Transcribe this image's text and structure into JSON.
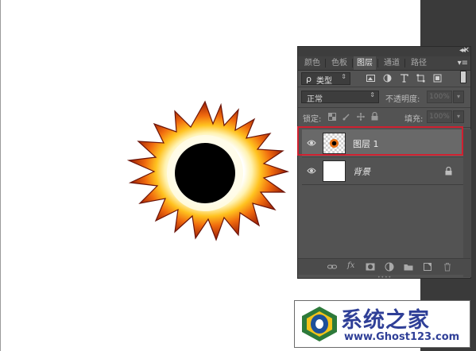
{
  "panel": {
    "tabs": [
      {
        "label": "颜色",
        "active": false
      },
      {
        "label": "色板",
        "active": false
      },
      {
        "label": "图层",
        "active": true
      },
      {
        "label": "通道",
        "active": false
      },
      {
        "label": "路径",
        "active": false
      }
    ],
    "filter": {
      "search_symbol": "ρ",
      "kind_label": "类型"
    },
    "blend_mode": "正常",
    "opacity_label": "不透明度:",
    "opacity_value": "100%",
    "lock_label": "锁定:",
    "fill_label": "填充:",
    "fill_value": "100%",
    "layers": [
      {
        "name": "图层 1",
        "selected": true,
        "visible": true,
        "locked": false
      },
      {
        "name": "背景",
        "selected": false,
        "visible": true,
        "locked": true
      }
    ],
    "bottom_icons": [
      "link-icon",
      "fx-icon",
      "mask-icon",
      "adjustment-icon",
      "folder-icon",
      "new-layer-icon",
      "trash-icon"
    ],
    "fx_label": "fx"
  },
  "watermark": {
    "name": "系统之家",
    "url": "www.Ghost123.com"
  },
  "colors": {
    "panel_bg": "#535353",
    "selected_row": "#696969",
    "highlight_border": "#d02030",
    "watermark_blue": "#2f3f97"
  }
}
